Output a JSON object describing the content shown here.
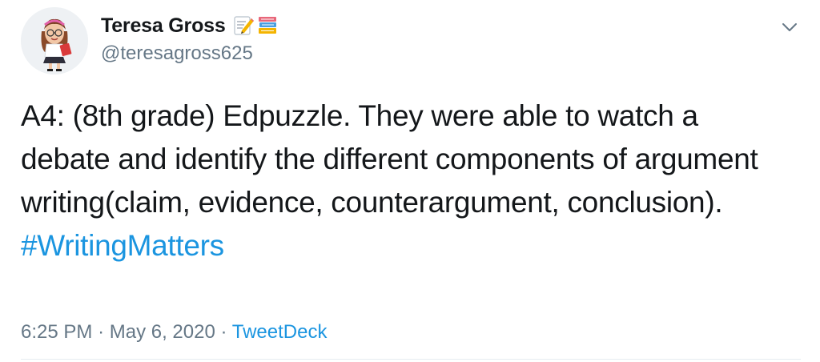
{
  "user": {
    "display_name": "Teresa Gross",
    "handle": "@teresagross625",
    "name_emoji": [
      "memo-icon",
      "books-icon"
    ]
  },
  "tweet": {
    "text": "A4: (8th grade) Edpuzzle. They were able to watch a debate and identify the different components of argument writing(claim, evidence, counterargument, conclusion).",
    "hashtag": "#WritingMatters"
  },
  "meta": {
    "time": "6:25 PM",
    "separator": "·",
    "date": "May 6, 2020",
    "source": "TweetDeck"
  },
  "colors": {
    "text": "#14171a",
    "secondary": "#657786",
    "link": "#1b95e0",
    "divider": "#e6ecf0"
  }
}
